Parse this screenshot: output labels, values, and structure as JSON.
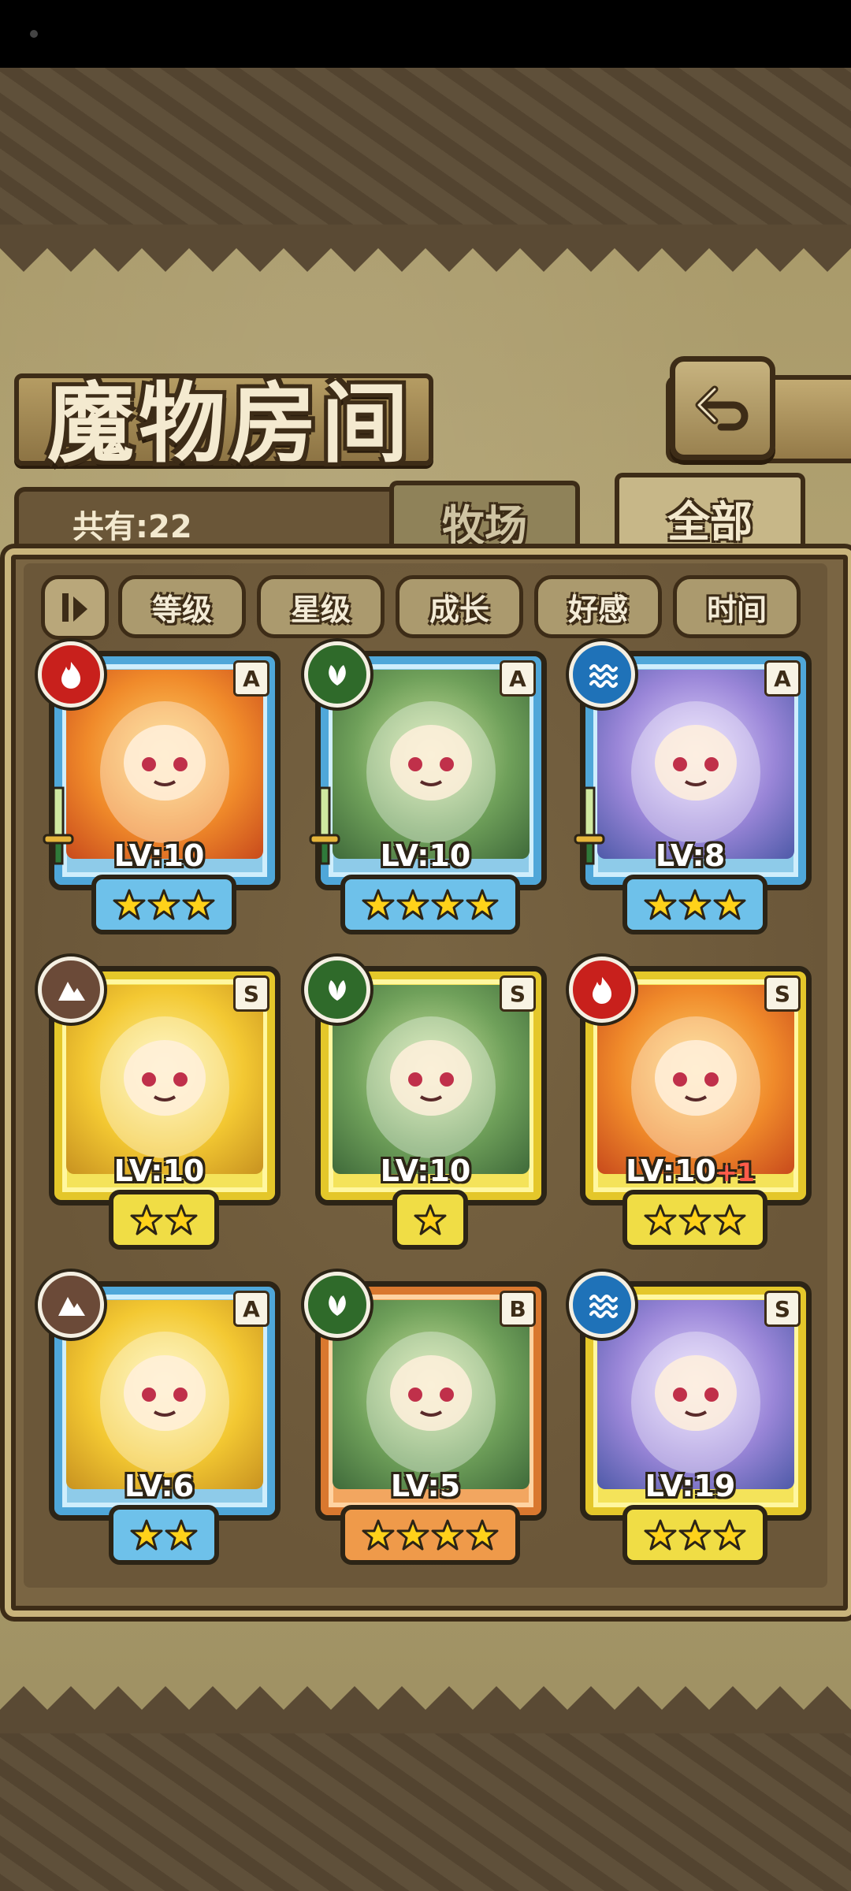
{
  "header": {
    "title": "魔物房间",
    "back_icon": "back-arrow-icon"
  },
  "summary": {
    "count_label": "共有:22"
  },
  "tabs": [
    {
      "label": "牧场",
      "active": false
    },
    {
      "label": "全部",
      "active": true
    }
  ],
  "sort": {
    "toggle_icon": "sort-toggle-icon",
    "buttons": [
      "等级",
      "星级",
      "成长",
      "好感",
      "时间"
    ]
  },
  "colors": {
    "fire": "#c8201c",
    "grass": "#2f6a2a",
    "water": "#1f72b8",
    "earth": "#6b4a38",
    "frame_blue": "#4fa7d9",
    "frame_gold": "#e4c72a",
    "frame_orange": "#d9782f"
  },
  "monsters": [
    {
      "element": "fire",
      "rank": "A",
      "level": "LV:10",
      "stars": 3,
      "frame": "blue",
      "equipped": true
    },
    {
      "element": "grass",
      "rank": "A",
      "level": "LV:10",
      "stars": 4,
      "frame": "blue",
      "equipped": true
    },
    {
      "element": "water",
      "rank": "A",
      "level": "LV:8",
      "stars": 3,
      "frame": "blue",
      "equipped": true
    },
    {
      "element": "earth",
      "rank": "S",
      "level": "LV:10",
      "stars": 2,
      "frame": "gold",
      "equipped": false
    },
    {
      "element": "grass",
      "rank": "S",
      "level": "LV:10",
      "stars": 1,
      "frame": "gold",
      "equipped": false
    },
    {
      "element": "fire",
      "rank": "S",
      "level": "LV:10",
      "level_bonus": "+1",
      "stars": 3,
      "frame": "gold",
      "equipped": false
    },
    {
      "element": "earth",
      "rank": "A",
      "level": "LV:6",
      "stars": 2,
      "frame": "blue",
      "equipped": false
    },
    {
      "element": "grass",
      "rank": "B",
      "level": "LV:5",
      "stars": 4,
      "frame": "orange",
      "equipped": false
    },
    {
      "element": "water",
      "rank": "S",
      "level": "LV:19",
      "stars": 3,
      "frame": "gold",
      "equipped": false
    }
  ]
}
